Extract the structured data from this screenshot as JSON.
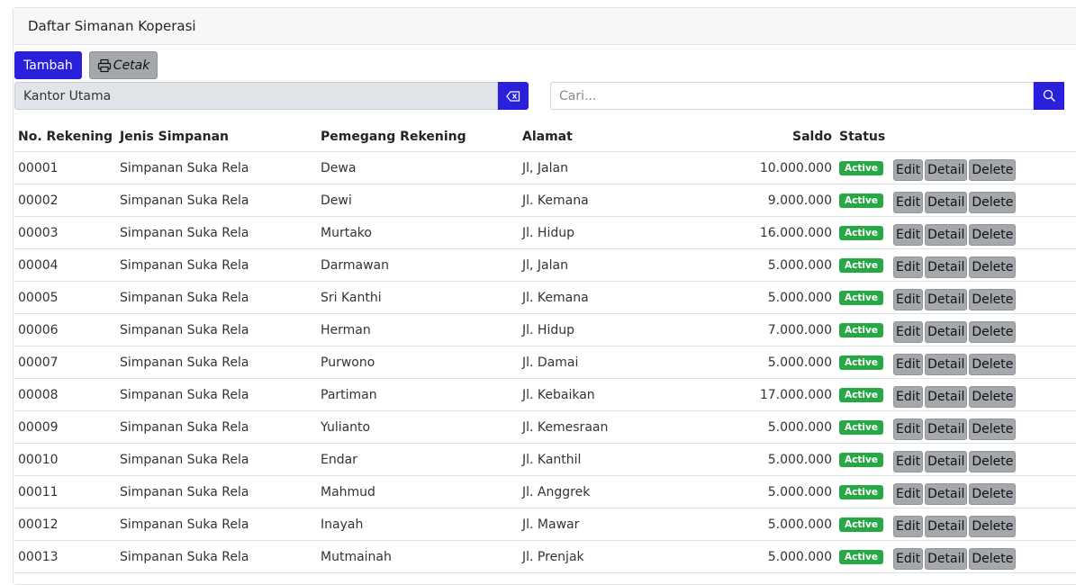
{
  "header": {
    "title": "Daftar Simanan Koperasi"
  },
  "toolbar": {
    "add_label": "Tambah",
    "print_label": "Cetak"
  },
  "filter": {
    "branch_value": "Kantor Utama",
    "search_placeholder": "Cari..."
  },
  "table": {
    "columns": [
      "No. Rekening",
      "Jenis Simpanan",
      "Pemegang Rekening",
      "Alamat",
      "Saldo",
      "Status"
    ],
    "action_labels": {
      "edit": "Edit",
      "detail": "Detail",
      "delete": "Delete"
    },
    "rows": [
      {
        "no": "00001",
        "jenis": "Simpanan Suka Rela",
        "pemegang": "Dewa",
        "alamat": "Jl, Jalan",
        "saldo": "10.000.000",
        "status": "Active"
      },
      {
        "no": "00002",
        "jenis": "Simpanan Suka Rela",
        "pemegang": "Dewi",
        "alamat": "Jl. Kemana",
        "saldo": "9.000.000",
        "status": "Active"
      },
      {
        "no": "00003",
        "jenis": "Simpanan Suka Rela",
        "pemegang": "Murtako",
        "alamat": "Jl. Hidup",
        "saldo": "16.000.000",
        "status": "Active"
      },
      {
        "no": "00004",
        "jenis": "Simpanan Suka Rela",
        "pemegang": "Darmawan",
        "alamat": "Jl, Jalan",
        "saldo": "5.000.000",
        "status": "Active"
      },
      {
        "no": "00005",
        "jenis": "Simpanan Suka Rela",
        "pemegang": "Sri Kanthi",
        "alamat": "Jl. Kemana",
        "saldo": "5.000.000",
        "status": "Active"
      },
      {
        "no": "00006",
        "jenis": "Simpanan Suka Rela",
        "pemegang": "Herman",
        "alamat": "Jl. Hidup",
        "saldo": "7.000.000",
        "status": "Active"
      },
      {
        "no": "00007",
        "jenis": "Simpanan Suka Rela",
        "pemegang": "Purwono",
        "alamat": "Jl. Damai",
        "saldo": "5.000.000",
        "status": "Active"
      },
      {
        "no": "00008",
        "jenis": "Simpanan Suka Rela",
        "pemegang": "Partiman",
        "alamat": "Jl. Kebaikan",
        "saldo": "17.000.000",
        "status": "Active"
      },
      {
        "no": "00009",
        "jenis": "Simpanan Suka Rela",
        "pemegang": "Yulianto",
        "alamat": "Jl. Kemesraan",
        "saldo": "5.000.000",
        "status": "Active"
      },
      {
        "no": "00010",
        "jenis": "Simpanan Suka Rela",
        "pemegang": "Endar",
        "alamat": "Jl. Kanthil",
        "saldo": "5.000.000",
        "status": "Active"
      },
      {
        "no": "00011",
        "jenis": "Simpanan Suka Rela",
        "pemegang": "Mahmud",
        "alamat": "Jl. Anggrek",
        "saldo": "5.000.000",
        "status": "Active"
      },
      {
        "no": "00012",
        "jenis": "Simpanan Suka Rela",
        "pemegang": "Inayah",
        "alamat": "Jl. Mawar",
        "saldo": "5.000.000",
        "status": "Active"
      },
      {
        "no": "00013",
        "jenis": "Simpanan Suka Rela",
        "pemegang": "Mutmainah",
        "alamat": "Jl. Prenjak",
        "saldo": "5.000.000",
        "status": "Active"
      }
    ]
  },
  "colors": {
    "primary": "#2a1fdb",
    "secondary": "#a4a8ad",
    "success": "#28a745"
  },
  "icons": {
    "print": "printer-icon",
    "clear": "backspace-icon",
    "search": "search-icon"
  }
}
